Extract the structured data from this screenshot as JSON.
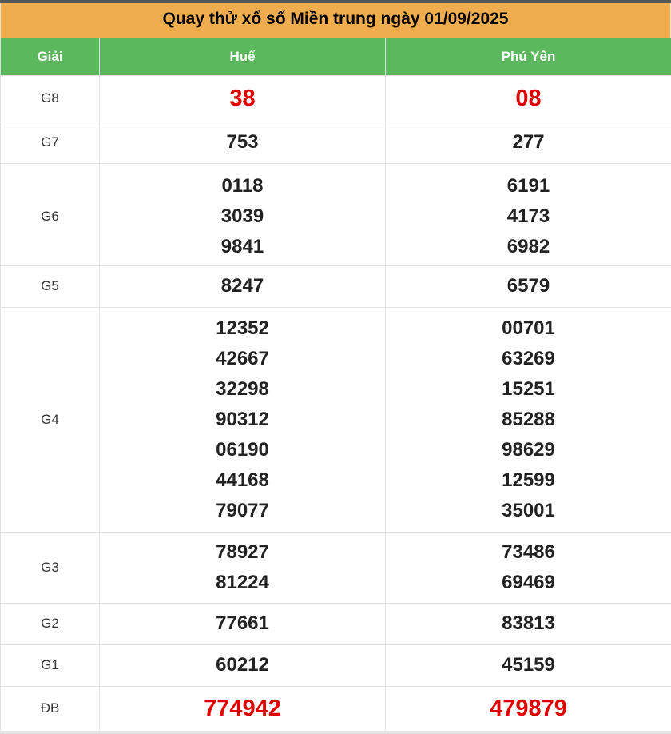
{
  "header": {
    "title": "Quay thử xổ số Miền trung ngày 01/09/2025"
  },
  "columns": {
    "prize": "Giải",
    "province_1": "Huế",
    "province_2": "Phú Yên"
  },
  "rows": [
    {
      "key": "g8",
      "prize": "G8",
      "style": "red",
      "hue": [
        "38"
      ],
      "phuyen": [
        "08"
      ]
    },
    {
      "key": "g7",
      "prize": "G7",
      "style": "normal",
      "hue": [
        "753"
      ],
      "phuyen": [
        "277"
      ]
    },
    {
      "key": "g6",
      "prize": "G6",
      "style": "normal",
      "hue": [
        "0118",
        "3039",
        "9841"
      ],
      "phuyen": [
        "6191",
        "4173",
        "6982"
      ]
    },
    {
      "key": "g5",
      "prize": "G5",
      "style": "normal",
      "hue": [
        "8247"
      ],
      "phuyen": [
        "6579"
      ]
    },
    {
      "key": "g4",
      "prize": "G4",
      "style": "normal",
      "hue": [
        "12352",
        "42667",
        "32298",
        "90312",
        "06190",
        "44168",
        "79077"
      ],
      "phuyen": [
        "00701",
        "63269",
        "15251",
        "85288",
        "98629",
        "12599",
        "35001"
      ]
    },
    {
      "key": "g3",
      "prize": "G3",
      "style": "normal",
      "hue": [
        "78927",
        "81224"
      ],
      "phuyen": [
        "73486",
        "69469"
      ]
    },
    {
      "key": "g2",
      "prize": "G2",
      "style": "normal",
      "hue": [
        "77661"
      ],
      "phuyen": [
        "83813"
      ]
    },
    {
      "key": "g1",
      "prize": "G1",
      "style": "normal",
      "hue": [
        "60212"
      ],
      "phuyen": [
        "45159"
      ]
    },
    {
      "key": "db",
      "prize": "ĐB",
      "style": "big",
      "hue": [
        "774942"
      ],
      "phuyen": [
        "479879"
      ]
    }
  ],
  "colors": {
    "title_bg": "#f0ad4e",
    "header_bg": "#5cb85c",
    "highlight_red": "#e00000"
  }
}
